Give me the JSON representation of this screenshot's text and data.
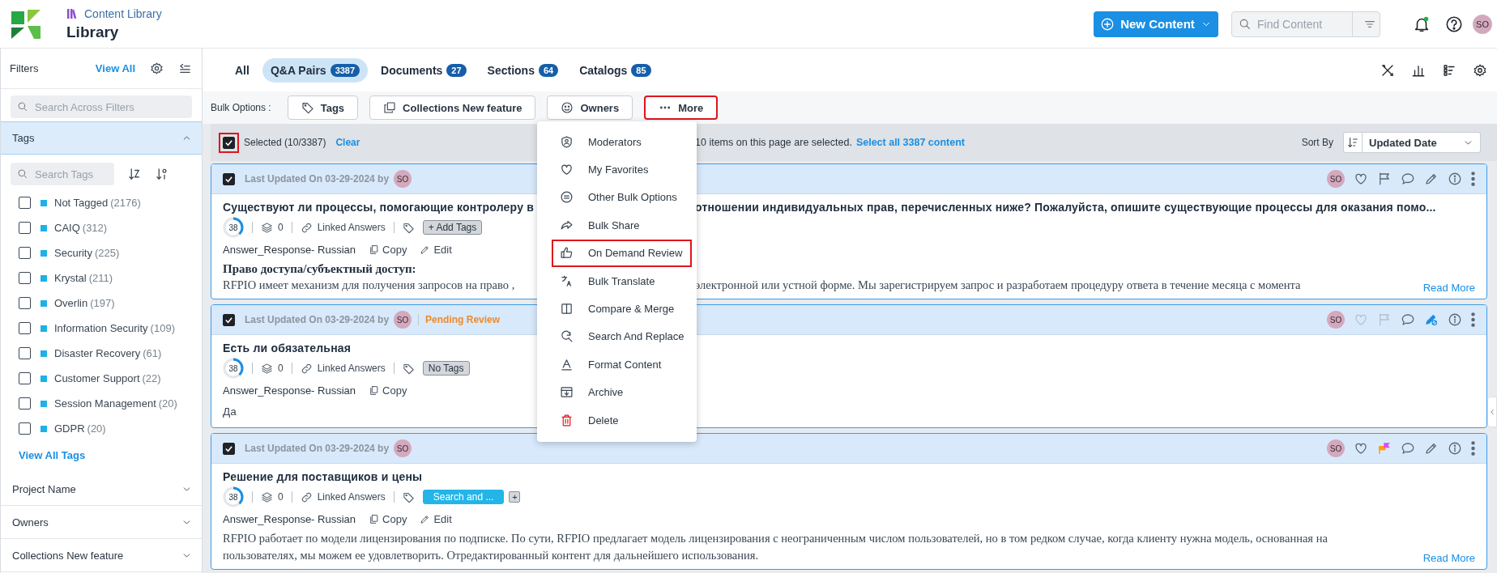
{
  "header": {
    "app_name": "Content Library",
    "page_title": "Library",
    "new_button": "New Content",
    "search": {
      "placeholder": "Find Content"
    },
    "avatar": "SO"
  },
  "sidebar": {
    "title": "Filters",
    "view_all": "View All",
    "search": {
      "placeholder": "Search Across Filters"
    },
    "sections": [
      {
        "title": "Tags",
        "expanded": true,
        "search": {
          "placeholder": "Search Tags"
        },
        "items": [
          {
            "label": "Not Tagged",
            "count": "(2176)",
            "checked": false
          },
          {
            "label": "CAIQ",
            "count": "(312)",
            "checked": false
          },
          {
            "label": "Security",
            "count": "(225)",
            "checked": false
          },
          {
            "label": "Krystal",
            "count": "(211)",
            "checked": false
          },
          {
            "label": "Overlin",
            "count": "(197)",
            "checked": false
          },
          {
            "label": "Information Security",
            "count": "(109)",
            "checked": false
          },
          {
            "label": "Disaster Recovery",
            "count": "(61)",
            "checked": false
          },
          {
            "label": "Customer Support",
            "count": "(22)",
            "checked": false
          },
          {
            "label": "Session Management",
            "count": "(20)",
            "checked": false
          },
          {
            "label": "GDPR",
            "count": "(20)",
            "checked": false
          }
        ],
        "view_all": "View All Tags"
      },
      {
        "title": "Project Name",
        "expanded": false
      },
      {
        "title": "Owners",
        "expanded": false
      },
      {
        "title": "Collections New feature",
        "expanded": false
      }
    ]
  },
  "tabs": [
    {
      "label": "All",
      "selected": false
    },
    {
      "label": "Q&A Pairs",
      "count": "3387",
      "selected": true
    },
    {
      "label": "Documents",
      "count": "27",
      "selected": false
    },
    {
      "label": "Sections",
      "count": "64",
      "selected": false
    },
    {
      "label": "Catalogs",
      "count": "85",
      "selected": false
    }
  ],
  "bulk_options": {
    "label": "Bulk Options :",
    "buttons": [
      {
        "kind": "tags",
        "label": "Tags",
        "highlighted": false
      },
      {
        "kind": "collections",
        "label": "Collections New feature",
        "highlighted": false
      },
      {
        "kind": "owners",
        "label": "Owners",
        "highlighted": false
      },
      {
        "kind": "more",
        "label": "More",
        "highlighted": true
      }
    ]
  },
  "selection": {
    "checked": true,
    "highlighted": true,
    "label": "Selected (10/3387)",
    "clear": "Clear",
    "message": "10 items on this page are selected.",
    "select_all": "Select all 3387 content",
    "sort_label": "Sort By",
    "sort_value": "Updated Date"
  },
  "more_menu": [
    {
      "kind": "moderators",
      "label": "Moderators",
      "highlighted": false
    },
    {
      "kind": "favorites",
      "label": "My Favorites",
      "highlighted": false
    },
    {
      "kind": "other",
      "label": "Other Bulk Options",
      "highlighted": false
    },
    {
      "kind": "share",
      "label": "Bulk Share",
      "highlighted": false
    },
    {
      "kind": "review",
      "label": "On Demand Review",
      "highlighted": true
    },
    {
      "kind": "translate",
      "label": "Bulk Translate",
      "highlighted": false
    },
    {
      "kind": "compare",
      "label": "Compare & Merge",
      "highlighted": false
    },
    {
      "kind": "replace",
      "label": "Search And Replace",
      "highlighted": false
    },
    {
      "kind": "format",
      "label": "Format Content",
      "highlighted": false
    },
    {
      "kind": "archive",
      "label": "Archive",
      "highlighted": false
    },
    {
      "kind": "delete",
      "label": "Delete",
      "highlighted": false
    }
  ],
  "cards": [
    {
      "checked": true,
      "updated": "Last Updated On 03-29-2024 by",
      "owner": "SO",
      "action_avatar": "SO",
      "actions": [
        {
          "kind": "heart",
          "disabled": false
        },
        {
          "kind": "flag",
          "disabled": false
        },
        {
          "kind": "comment",
          "disabled": false
        },
        {
          "kind": "edit",
          "disabled": false
        },
        {
          "kind": "info",
          "disabled": false
        },
        {
          "kind": "kebab",
          "disabled": false
        }
      ],
      "title_parts": [
        "Существуют ли процессы, помогающие контролеру в",
        "отношении индивидуальных прав, перечисленных ниже? Пожалуйста, опишите существующие процессы для оказания помо..."
      ],
      "score": "38",
      "level": 0.38,
      "versions": "0",
      "linked": "Linked Answers",
      "tag": {
        "kind": "add",
        "label": "+ Add Tags"
      },
      "answer_label": "Answer_Response- Russian",
      "answer_actions": [
        {
          "kind": "copy",
          "label": "Copy"
        },
        {
          "kind": "edit",
          "label": "Edit"
        }
      ],
      "body": {
        "kind": "serif",
        "heading": "Право доступа/субъектный доступ:",
        "parts": [
          "RFPIO имеет механизм для получения запросов на право ,",
          "электронной или устной форме. Мы зарегистрируем запрос и разработаем процедуру ответа в течение месяца с момента"
        ]
      },
      "read_more": "Read More"
    },
    {
      "checked": true,
      "updated": "Last Updated On 03-29-2024 by",
      "owner": "SO",
      "action_avatar": "SO",
      "status": "Pending Review",
      "actions": [
        {
          "kind": "heart",
          "disabled": true
        },
        {
          "kind": "flag",
          "disabled": true
        },
        {
          "kind": "comment",
          "disabled": false
        },
        {
          "kind": "edit-restricted",
          "disabled": false
        },
        {
          "kind": "info",
          "disabled": false
        },
        {
          "kind": "kebab",
          "disabled": false
        }
      ],
      "title_parts": [
        "Есть ли обязательная"
      ],
      "score": "38",
      "level": 0.38,
      "versions": "0",
      "linked": "Linked Answers",
      "tag": {
        "kind": "none",
        "label": "No Tags"
      },
      "answer_label": "Answer_Response- Russian",
      "answer_actions": [
        {
          "kind": "copy",
          "label": "Copy"
        }
      ],
      "body": {
        "kind": "sans",
        "parts": [
          "Да"
        ]
      }
    },
    {
      "checked": true,
      "updated": "Last Updated On 03-29-2024 by",
      "owner": "SO",
      "action_avatar": "SO",
      "actions": [
        {
          "kind": "heart",
          "disabled": false
        },
        {
          "kind": "flag-colored",
          "disabled": false
        },
        {
          "kind": "comment",
          "disabled": false
        },
        {
          "kind": "edit",
          "disabled": false
        },
        {
          "kind": "info",
          "disabled": false
        },
        {
          "kind": "kebab",
          "disabled": false
        }
      ],
      "title_parts": [
        "Решение для поставщиков и цены"
      ],
      "score": "38",
      "level": 0.38,
      "versions": "0",
      "linked": "Linked Answers",
      "tag": {
        "kind": "tag",
        "label": "Search and ...",
        "more": "+"
      },
      "answer_label": "Answer_Response- Russian",
      "answer_actions": [
        {
          "kind": "copy",
          "label": "Copy"
        },
        {
          "kind": "edit",
          "label": "Edit"
        }
      ],
      "body": {
        "kind": "serif",
        "parts": [
          "RFPIO работает по модели лицензирования по подписке. По сути, RFPIO предлагает модель лицензирования с неограниченным числом пользователей, но в том редком случае, когда клиенту нужна модель, основанная на пользователях, мы можем ее удовлетворить. Отредактированный контент для дальнейшего использования."
        ]
      },
      "read_more": "Read More"
    }
  ]
}
